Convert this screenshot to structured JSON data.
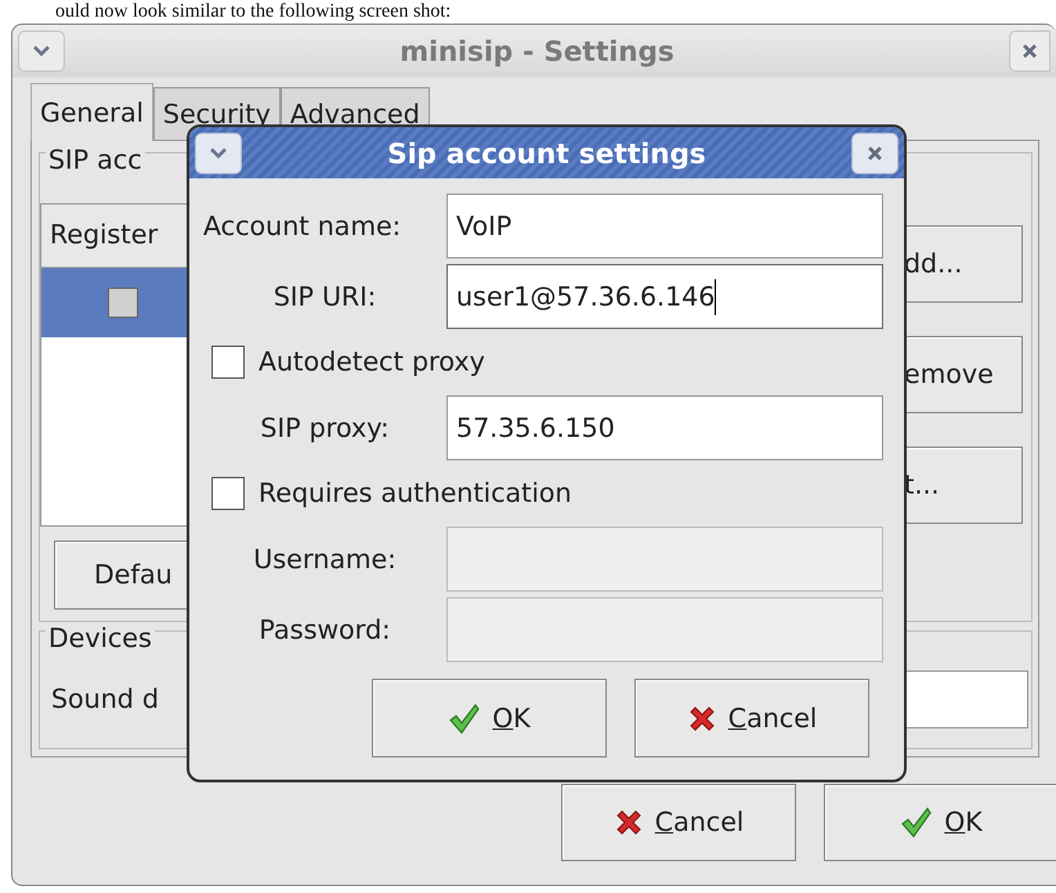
{
  "caption": "ould now look similar to the following screen shot:",
  "window": {
    "title": "minisip - Settings"
  },
  "tabs": [
    {
      "label": "General",
      "selected": true
    },
    {
      "label": "Security",
      "selected": false
    },
    {
      "label": "Advanced",
      "selected": false
    }
  ],
  "sip_accounts": {
    "title": "SIP acc",
    "columns": [
      "Register"
    ],
    "rows": [
      {
        "register": false,
        "selected": true
      }
    ],
    "side_buttons": [
      "dd...",
      "emove",
      "t..."
    ],
    "default_button": "Defau"
  },
  "devices": {
    "title": "Devices",
    "sound_label": "Sound d"
  },
  "buttons": [
    {
      "kind": "cancel",
      "mnemonic": "C",
      "rest": "ancel"
    },
    {
      "kind": "ok",
      "mnemonic": "O",
      "rest": "K"
    }
  ],
  "dialog": {
    "title": "Sip account settings",
    "fields": [
      {
        "kind": "text",
        "label": "Account name:",
        "value": "VoIP",
        "focused": false,
        "disabled": false
      },
      {
        "kind": "text",
        "label": "SIP URI:",
        "value": "user1@57.36.6.146",
        "focused": true,
        "disabled": false
      },
      {
        "kind": "checkbox",
        "label": "Autodetect proxy",
        "checked": false
      },
      {
        "kind": "text",
        "label": "SIP proxy:",
        "value": "57.35.6.150",
        "focused": false,
        "disabled": false
      },
      {
        "kind": "checkbox",
        "label": "Requires authentication",
        "checked": false
      },
      {
        "kind": "text",
        "label": "Username:",
        "focused": false,
        "disabled": true
      },
      {
        "kind": "text",
        "label": "Password:",
        "focused": false,
        "disabled": true
      }
    ],
    "buttons": [
      {
        "kind": "ok",
        "mnemonic": "O",
        "rest": "K"
      },
      {
        "kind": "cancel",
        "mnemonic": "C",
        "rest": "ancel"
      }
    ]
  }
}
